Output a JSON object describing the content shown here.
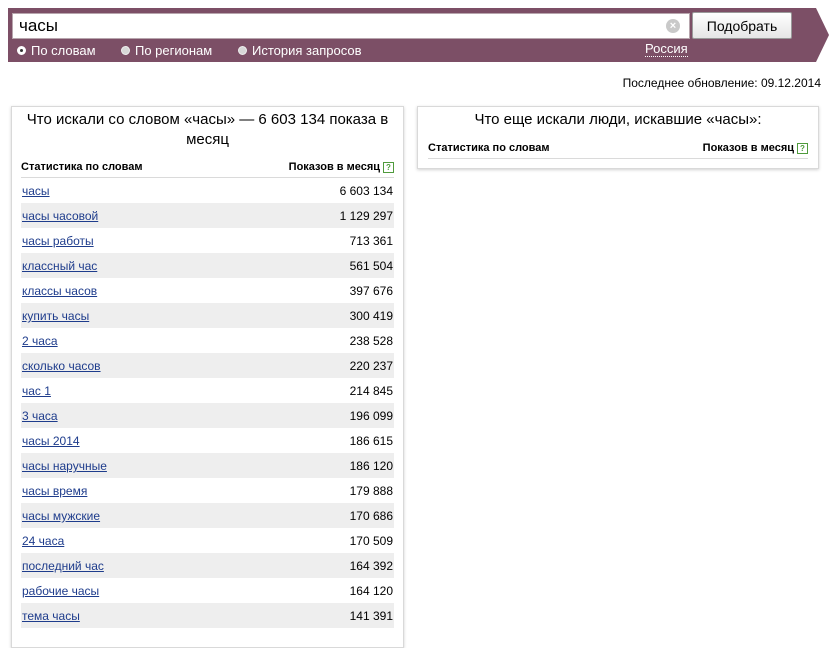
{
  "search": {
    "query": "часы",
    "submit_label": "Подобрать",
    "clear_symbol": "×"
  },
  "modes": [
    {
      "label": "По словам",
      "checked": true
    },
    {
      "label": "По регионам",
      "checked": false
    },
    {
      "label": "История запросов",
      "checked": false
    }
  ],
  "region": "Россия",
  "last_update": "Последнее обновление: 09.12.2014",
  "left_panel": {
    "title": "Что искали со словом «часы» — 6 603 134 показа в месяц",
    "col_keyword": "Статистика по словам",
    "col_count": "Показов в месяц",
    "help_symbol": "?",
    "rows": [
      {
        "keyword": "часы",
        "count": "6 603 134"
      },
      {
        "keyword": "часы часовой",
        "count": "1 129 297"
      },
      {
        "keyword": "часы работы",
        "count": "713 361"
      },
      {
        "keyword": "классный час",
        "count": "561 504"
      },
      {
        "keyword": "классы часов",
        "count": "397 676"
      },
      {
        "keyword": "купить часы",
        "count": "300 419"
      },
      {
        "keyword": "2 часа",
        "count": "238 528"
      },
      {
        "keyword": "сколько часов",
        "count": "220 237"
      },
      {
        "keyword": "час 1",
        "count": "214 845"
      },
      {
        "keyword": "3 часа",
        "count": "196 099"
      },
      {
        "keyword": "часы 2014",
        "count": "186 615"
      },
      {
        "keyword": "часы наручные",
        "count": "186 120"
      },
      {
        "keyword": "часы время",
        "count": "179 888"
      },
      {
        "keyword": "часы мужские",
        "count": "170 686"
      },
      {
        "keyword": "24 часа",
        "count": "170 509"
      },
      {
        "keyword": "последний час",
        "count": "164 392"
      },
      {
        "keyword": "рабочие часы",
        "count": "164 120"
      },
      {
        "keyword": "тема часы",
        "count": "141 391"
      }
    ]
  },
  "right_panel": {
    "title": "Что еще искали люди, искавшие «часы»:",
    "col_keyword": "Статистика по словам",
    "col_count": "Показов в месяц",
    "help_symbol": "?"
  }
}
